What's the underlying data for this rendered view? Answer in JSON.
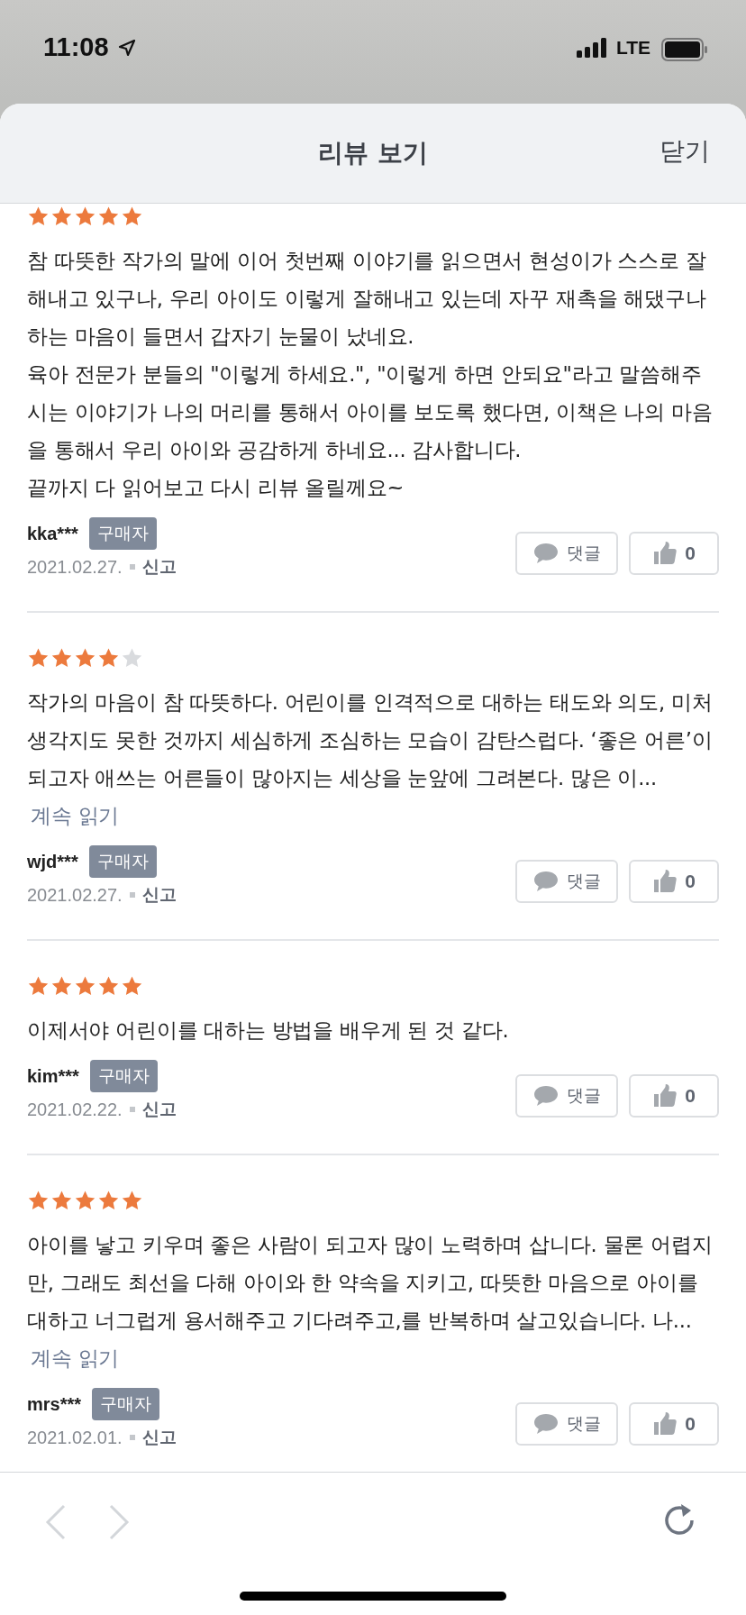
{
  "status_bar": {
    "time": "11:08",
    "network": "LTE"
  },
  "header": {
    "title": "리뷰 보기",
    "close": "닫기"
  },
  "reviews": [
    {
      "stars": 5,
      "text": "참 따뜻한 작가의 말에 이어 첫번째 이야기를 읽으면서 현성이가 스스로 잘해내고 있구나, 우리 아이도 이렇게 잘해내고 있는데 자꾸 재촉을 해댔구나 하는 마음이 들면서 갑자기 눈물이 났네요.\n육아 전문가 분들의 \"이렇게 하세요.\", \"이렇게 하면 안되요\"라고 말씀해주시는 이야기가 나의 머리를 통해서 아이를 보도록 했다면, 이책은 나의 마음을 통해서 우리 아이와 공감하게 하네요... 감사합니다.\n끝까지 다 읽어보고 다시 리뷰 올릴께요~",
      "author": "kka***",
      "badge": "구매자",
      "date": "2021.02.27.",
      "report": "신고",
      "comment": "댓글",
      "likes": "0"
    },
    {
      "stars": 4,
      "text": "작가의 마음이 참 따뜻하다. 어린이를 인격적으로 대하는 태도와 의도, 미처 생각지도 못한 것까지 세심하게 조심하는 모습이 감탄스럽다. ‘좋은 어른’이 되고자 애쓰는 어른들이 많아지는 세상을 눈앞에 그려본다. 많은 이...",
      "more": "계속 읽기",
      "author": "wjd***",
      "badge": "구매자",
      "date": "2021.02.27.",
      "report": "신고",
      "comment": "댓글",
      "likes": "0"
    },
    {
      "stars": 5,
      "text": "이제서야 어린이를 대하는 방법을 배우게 된 것 같다.",
      "author": "kim***",
      "badge": "구매자",
      "date": "2021.02.22.",
      "report": "신고",
      "comment": "댓글",
      "likes": "0"
    },
    {
      "stars": 5,
      "text": "아이를 낳고 키우며 좋은 사람이 되고자 많이 노력하며 삽니다. 물론 어렵지만, 그래도 최선을 다해 아이와 한 약속을 지키고, 따뜻한 마음으로 아이를 대하고 너그럽게 용서해주고 기다려주고,를 반복하며 살고있습니다. 나...",
      "more": "계속 읽기",
      "author": "mrs***",
      "badge": "구매자",
      "date": "2021.02.01.",
      "report": "신고",
      "comment": "댓글",
      "likes": "0"
    }
  ],
  "toolbar": {
    "back_disabled": true,
    "forward_disabled": true
  }
}
